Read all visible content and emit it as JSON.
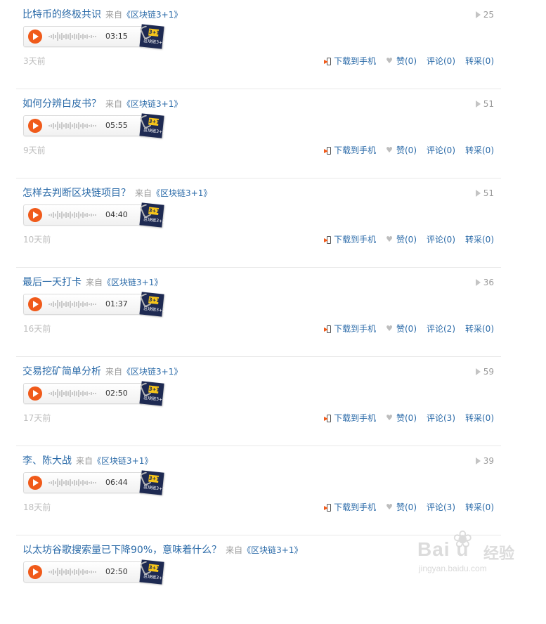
{
  "labels": {
    "from_prefix": "来自",
    "download": "下载到手机",
    "album_cover_num": "区块链3+1",
    "album_cover_tag": "3+1"
  },
  "items": [
    {
      "title": "比特币的终极共识",
      "album": "《区块链3+1》",
      "plays": "25",
      "duration": "03:15",
      "age": "3天前",
      "like": "赞(0)",
      "comment": "评论(0)",
      "repost": "转采(0)"
    },
    {
      "title": "如何分辨白皮书？",
      "album": "《区块链3+1》",
      "plays": "51",
      "duration": "05:55",
      "age": "9天前",
      "like": "赞(0)",
      "comment": "评论(0)",
      "repost": "转采(0)"
    },
    {
      "title": "怎样去判断区块链项目？",
      "album": "《区块链3+1》",
      "plays": "51",
      "duration": "04:40",
      "age": "10天前",
      "like": "赞(0)",
      "comment": "评论(0)",
      "repost": "转采(0)"
    },
    {
      "title": "最后一天打卡",
      "album": "《区块链3+1》",
      "plays": "36",
      "duration": "01:37",
      "age": "16天前",
      "like": "赞(0)",
      "comment": "评论(2)",
      "repost": "转采(0)"
    },
    {
      "title": "交易挖矿简单分析",
      "album": "《区块链3+1》",
      "plays": "59",
      "duration": "02:50",
      "age": "17天前",
      "like": "赞(0)",
      "comment": "评论(3)",
      "repost": "转采(0)"
    },
    {
      "title": "李、陈大战",
      "album": "《区块链3+1》",
      "plays": "39",
      "duration": "06:44",
      "age": "18天前",
      "like": "赞(0)",
      "comment": "评论(3)",
      "repost": "转采(0)"
    },
    {
      "title": "以太坊谷歌搜索量已下降90%，意味着什么？",
      "album": "《区块链3+1》",
      "plays": "",
      "duration": "02:50",
      "age": "",
      "like": "",
      "comment": "",
      "repost": ""
    }
  ],
  "watermark": {
    "brand": "Bai  u",
    "cn": "经验",
    "url": "jingyan.baidu.com"
  },
  "colors": {
    "link": "#2a6aa8",
    "play_button": "#f05a1a",
    "muted": "#9a9a9a"
  },
  "icons": [
    "play-icon",
    "download-to-phone-icon",
    "heart-icon",
    "play-count-icon",
    "album-cover-icon"
  ]
}
